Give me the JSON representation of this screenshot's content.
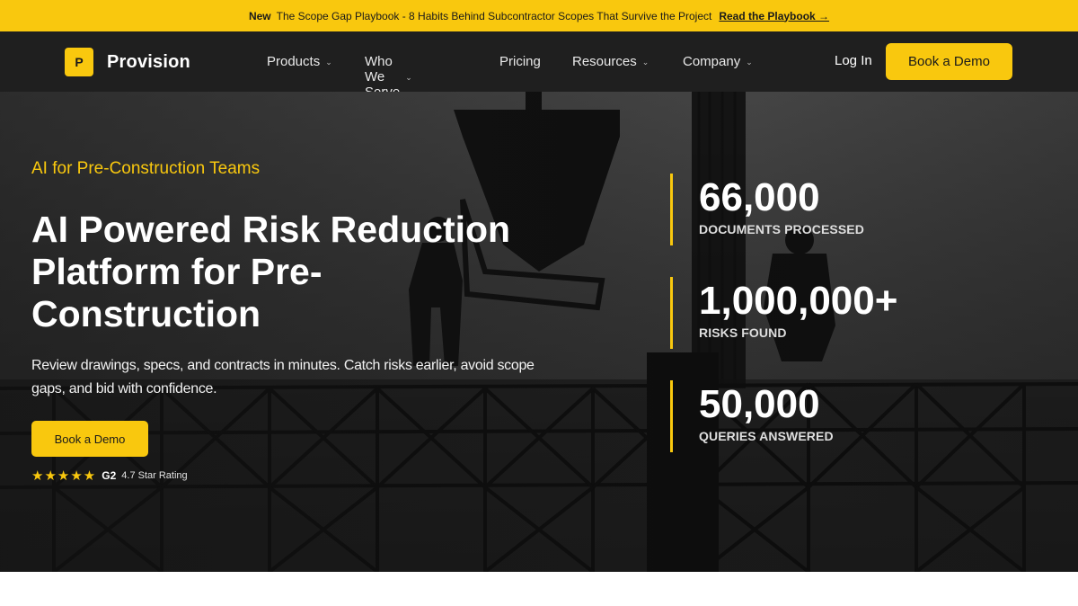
{
  "announcement": {
    "tag": "New",
    "text": "The Scope Gap Playbook - 8 Habits Behind Subcontractor Scopes That Survive the Project",
    "link": "Read the Playbook →"
  },
  "nav": {
    "logo_letter": "P",
    "brand": "Provision",
    "items": [
      {
        "label": "Products",
        "has_dropdown": true
      },
      {
        "label": "Who We Serve",
        "has_dropdown": true
      },
      {
        "label": "Pricing",
        "has_dropdown": false
      },
      {
        "label": "Resources",
        "has_dropdown": true
      },
      {
        "label": "Company",
        "has_dropdown": true
      }
    ],
    "login": "Log In",
    "cta": "Book a Demo"
  },
  "hero": {
    "eyebrow": "AI for Pre-Construction Teams",
    "headline": "AI Powered Risk Reduction Platform for Pre-Construction",
    "subtext": "Review drawings, specs, and contracts in minutes. Catch risks earlier, avoid scope gaps, and bid with confidence.",
    "cta": "Book a Demo",
    "rating": {
      "stars": "★★★★★",
      "platform": "G2",
      "text": "4.7 Star Rating"
    }
  },
  "stats": [
    {
      "value": "66,000",
      "label": "DOCUMENTS PROCESSED"
    },
    {
      "value": "1,000,000+",
      "label": "RISKS FOUND"
    },
    {
      "value": "50,000",
      "label": "QUERIES ANSWERED"
    }
  ],
  "colors": {
    "accent": "#f9c80e",
    "nav_bg": "#1f1f1f",
    "hero_bg": "#3b3b3b"
  },
  "icons": {
    "dropdown": "chevron-down-icon",
    "star": "star-icon"
  }
}
